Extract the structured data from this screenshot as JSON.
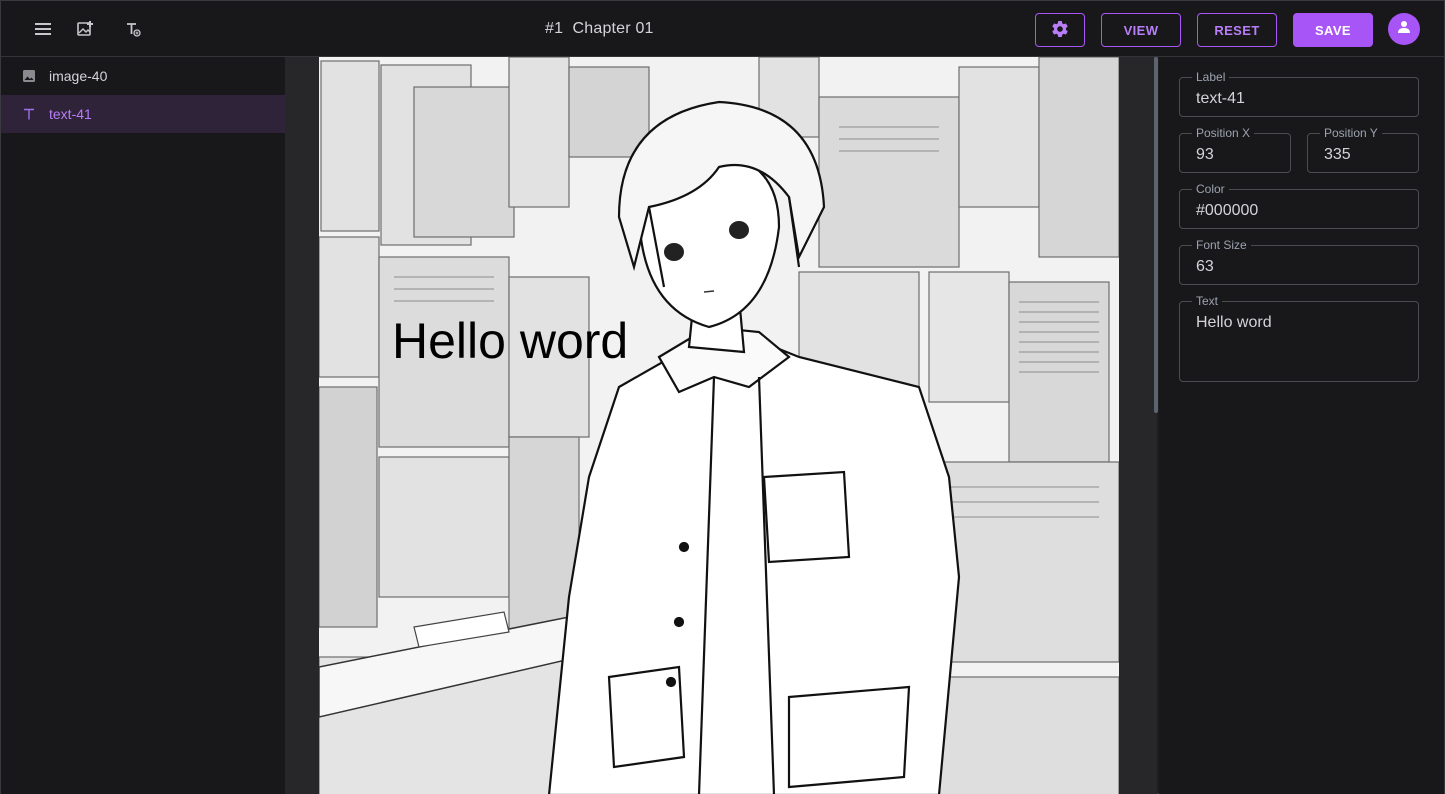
{
  "toolbar": {
    "title": "#1  Chapter 01",
    "buttons": {
      "view": "VIEW",
      "reset": "RESET",
      "save": "SAVE"
    },
    "icons": [
      "menu-icon",
      "add-image-icon",
      "add-text-icon",
      "gear-icon",
      "user-icon"
    ],
    "accent": "#a855f7"
  },
  "layers": [
    {
      "label": "image-40",
      "icon": "image-icon",
      "active": false
    },
    {
      "label": "text-41",
      "icon": "text-icon",
      "active": true
    }
  ],
  "canvas": {
    "overlay_text": "Hello word",
    "overlay_color": "#000000"
  },
  "properties": {
    "label": {
      "title": "Label",
      "value": "text-41"
    },
    "position_x": {
      "title": "Position X",
      "value": "93"
    },
    "position_y": {
      "title": "Position Y",
      "value": "335"
    },
    "color": {
      "title": "Color",
      "value": "#000000"
    },
    "font_size": {
      "title": "Font Size",
      "value": "63"
    },
    "text": {
      "title": "Text",
      "value": "Hello word"
    }
  }
}
